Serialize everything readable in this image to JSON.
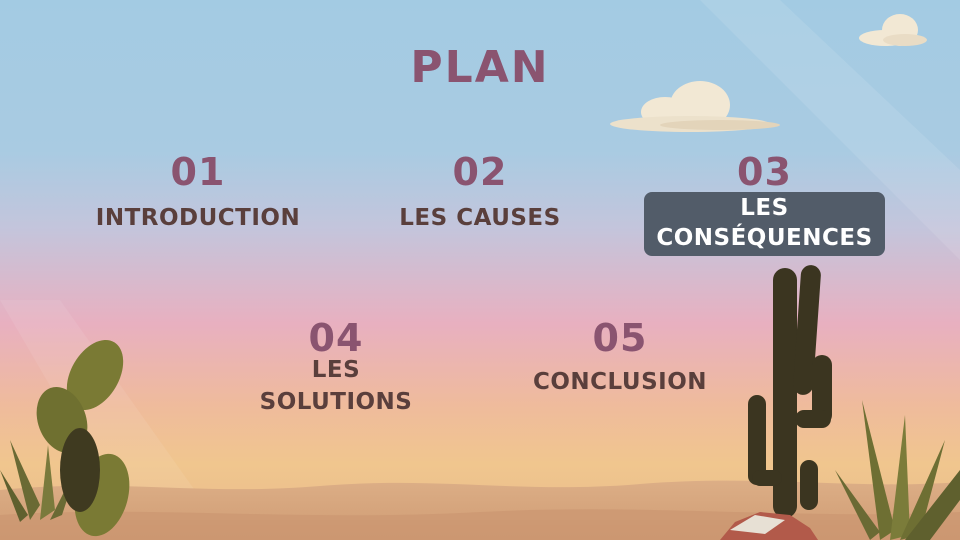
{
  "slide": {
    "title": "PLAN",
    "items": [
      {
        "number": "01",
        "label": "INTRODUCTION"
      },
      {
        "number": "02",
        "label": "LES CAUSES"
      },
      {
        "number": "03",
        "label_line1": "LES",
        "label_line2": "CONSÉQUENCES"
      },
      {
        "number": "04",
        "label_line1": "LES",
        "label_line2": "SOLUTIONS"
      },
      {
        "number": "05",
        "label": "CONCLUSION"
      }
    ]
  },
  "colors": {
    "title": "#8a5470",
    "label": "#5a3f3c",
    "highlight_bg": "#525c69",
    "sand": "#d9a77e",
    "cactus": "#4f5a2a"
  },
  "icons": [
    "cloud-icon",
    "cactus-icon",
    "agave-icon",
    "rock-icon"
  ]
}
